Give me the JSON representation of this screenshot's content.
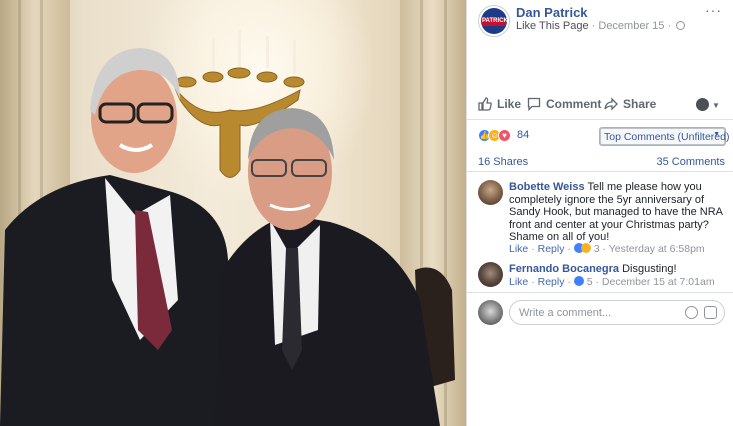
{
  "post": {
    "page_name": "Dan Patrick",
    "page_logo_text": "PATRICK",
    "like_this_page": "Like This Page",
    "separator": "·",
    "date": "December 15",
    "separator2": "·",
    "more": "···"
  },
  "actions": {
    "like": "Like",
    "comment": "Comment",
    "share": "Share"
  },
  "reactions": {
    "count": "84",
    "types": [
      "like-icon",
      "haha-icon",
      "love-icon"
    ],
    "colors": {
      "like": "#4080ff",
      "haha": "#f7b125",
      "love": "#f25268"
    }
  },
  "sort": {
    "selected": "Top Comments (Unfiltered)"
  },
  "stats": {
    "shares": "16 Shares",
    "comments": "35 Comments"
  },
  "comments": [
    {
      "author": "Bobette Weiss",
      "text": "Tell me please how you completely ignore the 5yr anniversary of Sandy Hook, but managed to have the NRA front and center at your Christmas party? Shame on all of you!",
      "like": "Like",
      "dot": "·",
      "reply": "Reply",
      "dot2": "·",
      "reaction_count": "3",
      "dot3": "·",
      "time": "Yesterday at 6:58pm"
    },
    {
      "author": "Fernando Bocanegra",
      "text": "Disgusting!",
      "like": "Like",
      "dot": "·",
      "reply": "Reply",
      "dot2": "·",
      "reaction_count": "5",
      "dot3": "·",
      "time": "December 15 at 7:01am"
    }
  ],
  "composer": {
    "placeholder": "Write a comment..."
  },
  "theme": {
    "link": "#365899",
    "muted": "#90949c",
    "border": "#dddfe2"
  }
}
